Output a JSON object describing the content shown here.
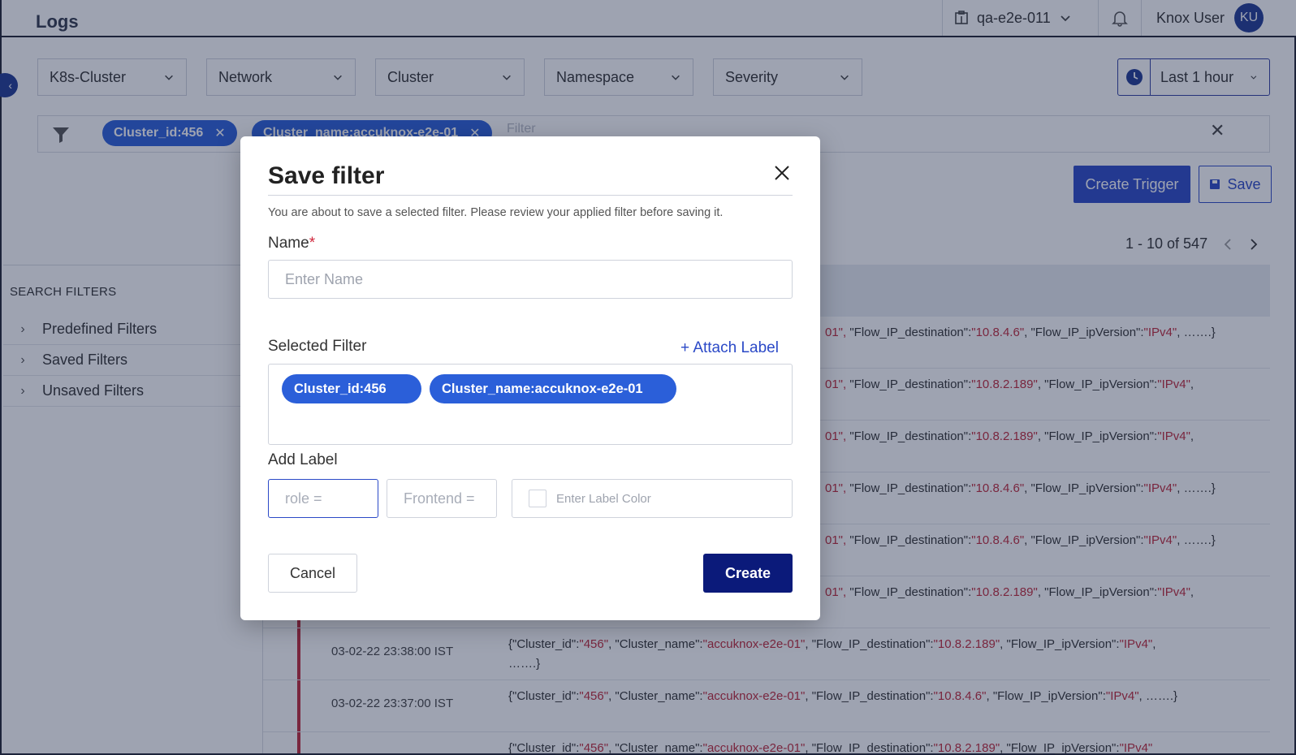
{
  "header": {
    "title": "Logs",
    "tenant": "qa-e2e-011",
    "user_name": "Knox User",
    "user_initials": "KU"
  },
  "filters": {
    "dropdowns": [
      "K8s-Cluster",
      "Network",
      "Cluster",
      "Namespace",
      "Severity"
    ],
    "time_range": "Last 1 hour",
    "applied_chips": [
      "Cluster_id:456",
      "Cluster_name:accuknox-e2e-01"
    ],
    "filter_placeholder": "Filter"
  },
  "actions": {
    "create_trigger": "Create Trigger",
    "save": "Save"
  },
  "pagination": {
    "range": "1 - 10 of 547"
  },
  "sidebar": {
    "heading": "SEARCH FILTERS",
    "items": [
      "Predefined Filters",
      "Saved Filters",
      "Unsaved Filters"
    ]
  },
  "logs": {
    "rows": [
      {
        "timestamp": "",
        "fragment": "01\",",
        "destination": "10.8.4.6",
        "ip_version": "IPv4",
        "tail": "…….}"
      },
      {
        "timestamp": "",
        "fragment": "01\",",
        "destination": "10.8.2.189",
        "ip_version": "IPv4",
        "tail": ""
      },
      {
        "timestamp": "",
        "fragment": "01\",",
        "destination": "10.8.2.189",
        "ip_version": "IPv4",
        "tail": ""
      },
      {
        "timestamp": "",
        "fragment": "01\",",
        "destination": "10.8.4.6",
        "ip_version": "IPv4",
        "tail": "…….}"
      },
      {
        "timestamp": "",
        "fragment": "01\",",
        "destination": "10.8.4.6",
        "ip_version": "IPv4",
        "tail": "…….}"
      },
      {
        "timestamp": "",
        "fragment": "01\",",
        "destination": "10.8.2.189",
        "ip_version": "IPv4",
        "tail": ""
      },
      {
        "timestamp": "03-02-22 23:38:00 IST",
        "cluster_id": "456",
        "cluster_name": "accuknox-e2e-01",
        "destination": "10.8.2.189",
        "ip_version": "IPv4",
        "tail": "…….}"
      },
      {
        "timestamp": "03-02-22 23:37:00 IST",
        "cluster_id": "456",
        "cluster_name": "accuknox-e2e-01",
        "destination": "10.8.4.6",
        "ip_version": "IPv4",
        "tail": "…….}"
      },
      {
        "timestamp": "",
        "cluster_id": "456",
        "cluster_name": "accuknox-e2e-01",
        "destination": "10.8.2.189",
        "ip_version": "IPv4",
        "tail": ""
      }
    ]
  },
  "modal": {
    "title": "Save filter",
    "description": "You are about to save a selected filter. Please review your applied filter before saving it.",
    "name_label": "Name",
    "required_mark": "*",
    "name_placeholder": "Enter Name",
    "selected_filter_label": "Selected Filter",
    "attach_label": "+ Attach Label",
    "selected_chips": [
      "Cluster_id:456",
      "Cluster_name:accuknox-e2e-01"
    ],
    "add_label": "Add Label",
    "label_key_placeholder": "role =",
    "label_value_placeholder": "Frontend =",
    "label_color_placeholder": "Enter Label Color",
    "cancel": "Cancel",
    "create": "Create"
  },
  "colors": {
    "primary": "#2b49c7",
    "chip": "#2b5fd9",
    "create_button": "#0b1a7a",
    "value_red": "#c0283a"
  }
}
